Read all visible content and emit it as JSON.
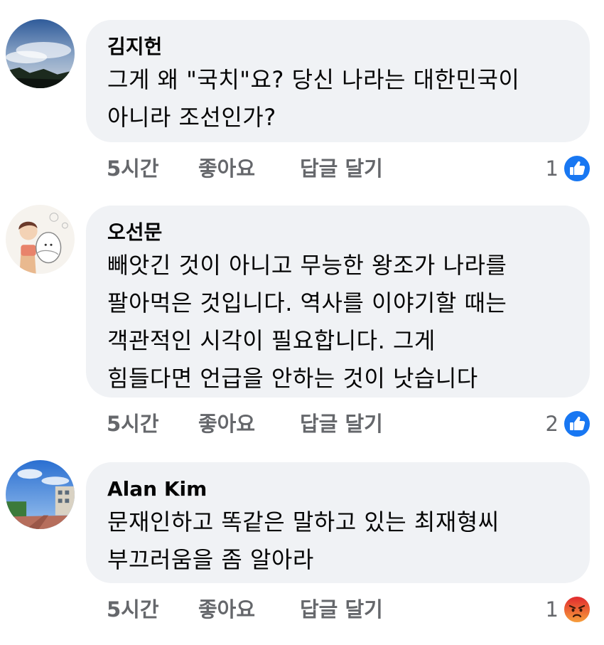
{
  "comments": [
    {
      "author": "김지헌",
      "lines": [
        "그게 왜 \"국치\"요? 당신 나라는 대한민국이",
        "아니라 조선인가?"
      ],
      "time": "5시간",
      "like_label": "좋아요",
      "reply_label": "답글 달기",
      "reaction_count": "1",
      "reaction_icon": "like-icon"
    },
    {
      "author": "오선문",
      "lines": [
        "빼앗긴 것이 아니고 무능한 왕조가 나라를",
        "팔아먹은 것입니다. 역사를 이야기할 때는",
        "객관적인 시각이 필요합니다. 그게",
        "힘들다면 언급을 안하는 것이 낫습니다"
      ],
      "time": "5시간",
      "like_label": "좋아요",
      "reply_label": "답글 달기",
      "reaction_count": "2",
      "reaction_icon": "like-icon"
    },
    {
      "author": "Alan Kim",
      "lines": [
        "문재인하고 똑같은 말하고 있는 최재형씨",
        "부끄러움을 좀 알아라"
      ],
      "time": "5시간",
      "like_label": "좋아요",
      "reply_label": "답글 달기",
      "reaction_count": "1",
      "reaction_icon": "angry-icon"
    }
  ],
  "colors": {
    "bubble": "#f0f2f5",
    "meta_text": "#65676b",
    "like_blue": "#1877f2",
    "angry_orange": "#f05a24"
  }
}
